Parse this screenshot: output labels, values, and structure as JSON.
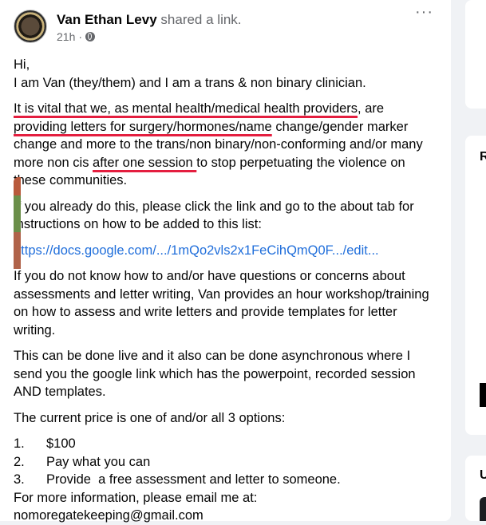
{
  "post": {
    "author": "Van Ethan Levy",
    "action": "shared a link.",
    "time": "21h",
    "more_icon": "···",
    "greeting": "Hi,",
    "intro": "I am Van (they/them) and I am a trans & non binary clinician.",
    "p1_a": "It is vital that we, as mental health/medical health providers",
    "p1_b": ", are",
    "p1_c": "providing letters for surgery/hormones/name",
    "p1_d": " change/gender marker change and more to the trans/non binary/non-conforming and/or many more non cis ",
    "p1_e": "after one session ",
    "p1_f": "to stop perpetuating the violence on these communities.",
    "p2": "If you already do this, please click the link and go to the about tab for instructions on how to be added to this list:",
    "link": "https://docs.google.com/.../1mQo2vls2x1FeCihQmQ0F.../edit...",
    "p3": "If you do not know how to and/or have questions or concerns about assessments and letter writing, Van provides an hour workshop/training on how to assess and write letters and provide templates for letter writing.",
    "p4": "This can be done live and it also can be done asynchronous where I send you the google link which has the powerpoint, recorded session AND templates.",
    "p5": "The current price is one of and/or all 3 options:",
    "options": [
      {
        "num": "1.",
        "text": "$100"
      },
      {
        "num": "2.",
        "text": "Pay what you can"
      },
      {
        "num": "3.",
        "text": "Provide  a free assessment and letter to someone."
      }
    ],
    "p6": "For more information, please email me at:",
    "email": "nomoregatekeeping@gmail.com"
  },
  "right_column": {
    "card2_letter": "R",
    "card3_letter": "U"
  }
}
